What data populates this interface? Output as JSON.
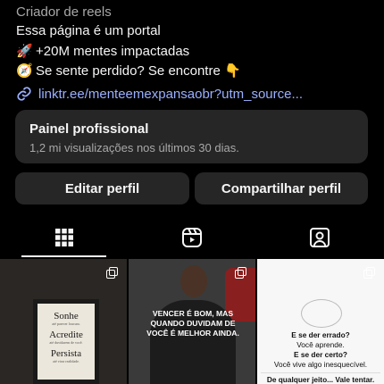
{
  "profile": {
    "category": "Criador de reels",
    "bio_lines": [
      {
        "emoji": "",
        "text": "Essa página é um portal"
      },
      {
        "emoji": "🚀",
        "text": "+20M mentes impactadas"
      },
      {
        "emoji": "🧭",
        "text": "Se sente perdido? Se encontre 👇"
      }
    ],
    "link": "linktr.ee/menteemexpansaobr?utm_source..."
  },
  "pro_panel": {
    "title": "Painel profissional",
    "subtitle": "1,2 mi visualizações nos últimos 30 dias."
  },
  "buttons": {
    "edit": "Editar perfil",
    "share": "Compartilhar perfil"
  },
  "tabs": [
    {
      "icon": "grid-icon",
      "active": true
    },
    {
      "icon": "reels-icon",
      "active": false
    },
    {
      "icon": "tagged-icon",
      "active": false
    }
  ],
  "posts": [
    {
      "type": "carousel",
      "frame_words": [
        {
          "word": "Sonhe",
          "sub": "até parecer loucura."
        },
        {
          "word": "Acredite",
          "sub": "até duvidarem de você."
        },
        {
          "word": "Persista",
          "sub": "até virar realidade."
        }
      ]
    },
    {
      "type": "carousel",
      "shirt_text": "VENCER É BOM, MAS QUANDO DUVIDAM DE VOCÊ É MELHOR AINDA."
    },
    {
      "type": "carousel",
      "quote": [
        {
          "style": "bold",
          "text": "E se der errado?"
        },
        {
          "style": "regular",
          "text": "Você aprende."
        },
        {
          "style": "bold",
          "text": "E se der certo?"
        },
        {
          "style": "regular",
          "text": "Você vive algo inesquecível."
        },
        {
          "style": "last",
          "text": "De qualquer jeito... Vale tentar."
        }
      ]
    }
  ],
  "colors": {
    "background": "#000000",
    "surface": "#262626",
    "text": "#f5f5f5",
    "muted": "#a8a8a8",
    "link": "#9ab0ff"
  }
}
